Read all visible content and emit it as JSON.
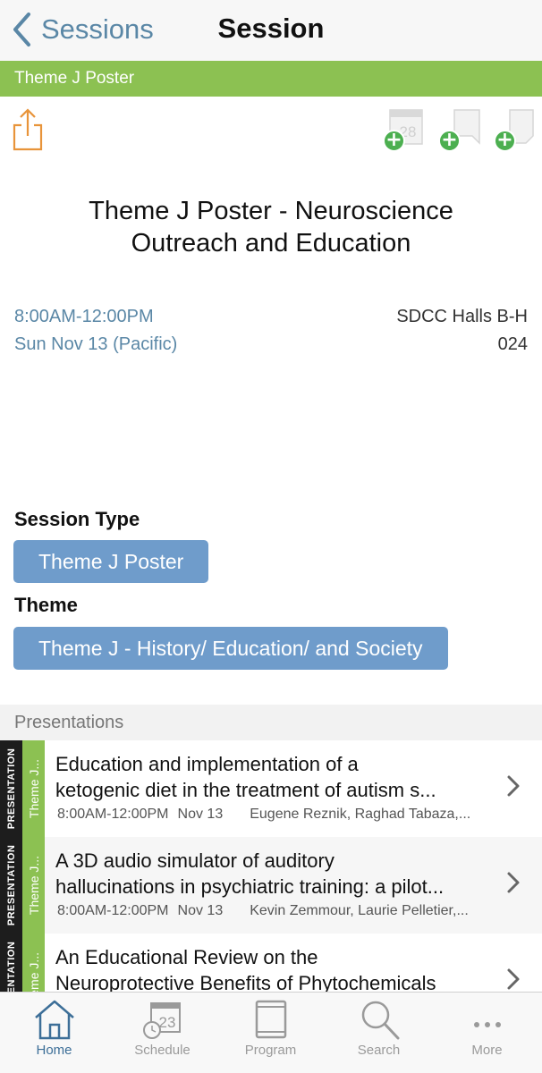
{
  "nav": {
    "back_label": "Sessions",
    "title": "Session"
  },
  "banner": {
    "text": "Theme J Poster"
  },
  "actions": {
    "share_icon": "share-icon",
    "calendar_day": "28",
    "colors": {
      "share": "#e8943a",
      "add": "#4caf50"
    }
  },
  "session": {
    "title_line1": "Theme J Poster - Neuroscience",
    "title_line2": "Outreach and Education",
    "time": "8:00AM-12:00PM",
    "date": "Sun Nov 13 (Pacific)",
    "location": "SDCC Halls B-H",
    "room": "024"
  },
  "session_type": {
    "heading": "Session Type",
    "value": "Theme J Poster"
  },
  "theme": {
    "heading": "Theme",
    "value": "Theme J - History/ Education/ and Society"
  },
  "presentations": {
    "heading": "Presentations",
    "items": [
      {
        "type_label": "PRESENTATION",
        "theme_label": "Theme J...",
        "title_line1": "Education and implementation of a",
        "title_line2": "ketogenic diet in the treatment of autism s...",
        "time": "8:00AM-12:00PM",
        "date": "Nov 13",
        "authors": "Eugene Reznik, Raghad Tabaza,..."
      },
      {
        "type_label": "PRESENTATION",
        "theme_label": "Theme J...",
        "title_line1": "A 3D audio simulator of auditory",
        "title_line2": "hallucinations in psychiatric training: a pilot...",
        "time": "8:00AM-12:00PM",
        "date": "Nov 13",
        "authors": "Kevin Zemmour, Laurie Pelletier,..."
      },
      {
        "type_label": "PRESENTATION",
        "theme_label": "Theme J...",
        "title_line1": "An Educational Review on the",
        "title_line2": "Neuroprotective Benefits of Phytochemicals",
        "time": "",
        "date": "",
        "authors": ""
      }
    ]
  },
  "tabs": [
    {
      "label": "Home",
      "icon": "home-icon",
      "active": true
    },
    {
      "label": "Schedule",
      "icon": "schedule-icon",
      "day": "23"
    },
    {
      "label": "Program",
      "icon": "program-icon"
    },
    {
      "label": "Search",
      "icon": "search-icon"
    },
    {
      "label": "More",
      "icon": "more-icon"
    }
  ]
}
